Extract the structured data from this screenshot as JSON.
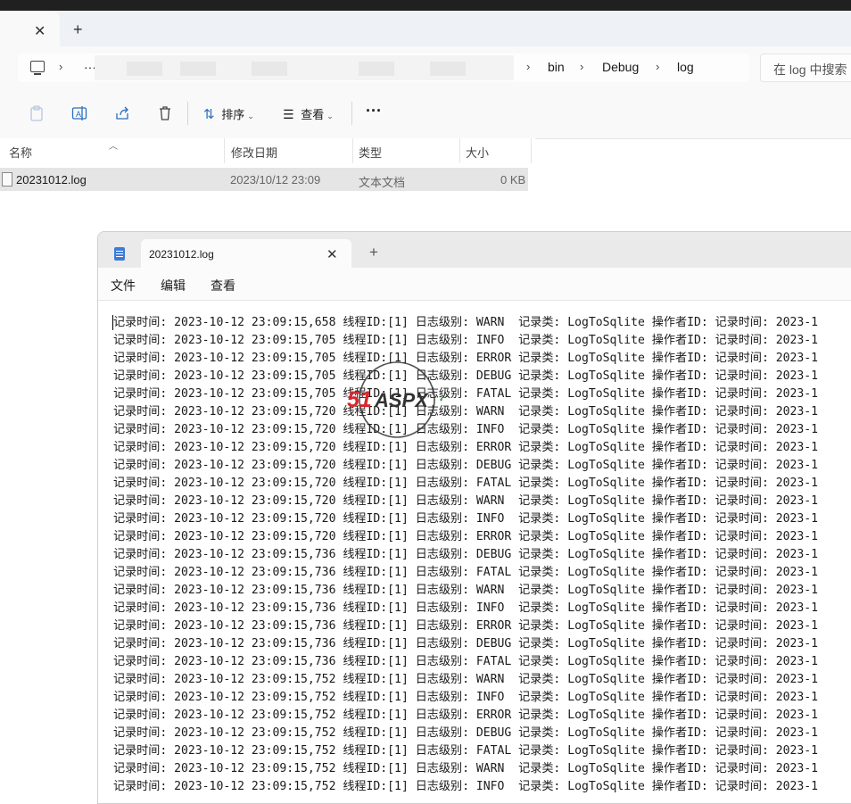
{
  "explorer": {
    "tab_close": "✕",
    "tab_new": "+",
    "breadcrumb": {
      "more": "···",
      "items": [
        "bin",
        "Debug",
        "log"
      ]
    },
    "search_placeholder": "在 log 中搜索",
    "toolbar": {
      "sort_label": "排序",
      "view_label": "查看",
      "more_label": "···"
    },
    "columns": [
      "名称",
      "修改日期",
      "类型",
      "大小"
    ],
    "files": [
      {
        "name": "20231012.log",
        "modified": "2023/10/12 23:09",
        "type": "文本文档",
        "size": "0 KB"
      }
    ]
  },
  "notepad": {
    "tab_title": "20231012.log",
    "tab_close": "✕",
    "tab_new": "+",
    "menu": [
      "文件",
      "编辑",
      "查看"
    ],
    "log_lines": [
      "记录时间: 2023-10-12 23:09:15,658 线程ID:[1] 日志级别: WARN  记录类: LogToSqlite 操作者ID: 记录时间: 2023-1",
      "记录时间: 2023-10-12 23:09:15,705 线程ID:[1] 日志级别: INFO  记录类: LogToSqlite 操作者ID: 记录时间: 2023-1",
      "记录时间: 2023-10-12 23:09:15,705 线程ID:[1] 日志级别: ERROR 记录类: LogToSqlite 操作者ID: 记录时间: 2023-1",
      "记录时间: 2023-10-12 23:09:15,705 线程ID:[1] 日志级别: DEBUG 记录类: LogToSqlite 操作者ID: 记录时间: 2023-1",
      "记录时间: 2023-10-12 23:09:15,705 线程ID:[1] 日志级别: FATAL 记录类: LogToSqlite 操作者ID: 记录时间: 2023-1",
      "记录时间: 2023-10-12 23:09:15,720 线程ID:[1] 日志级别: WARN  记录类: LogToSqlite 操作者ID: 记录时间: 2023-1",
      "记录时间: 2023-10-12 23:09:15,720 线程ID:[1] 日志级别: INFO  记录类: LogToSqlite 操作者ID: 记录时间: 2023-1",
      "记录时间: 2023-10-12 23:09:15,720 线程ID:[1] 日志级别: ERROR 记录类: LogToSqlite 操作者ID: 记录时间: 2023-1",
      "记录时间: 2023-10-12 23:09:15,720 线程ID:[1] 日志级别: DEBUG 记录类: LogToSqlite 操作者ID: 记录时间: 2023-1",
      "记录时间: 2023-10-12 23:09:15,720 线程ID:[1] 日志级别: FATAL 记录类: LogToSqlite 操作者ID: 记录时间: 2023-1",
      "记录时间: 2023-10-12 23:09:15,720 线程ID:[1] 日志级别: WARN  记录类: LogToSqlite 操作者ID: 记录时间: 2023-1",
      "记录时间: 2023-10-12 23:09:15,720 线程ID:[1] 日志级别: INFO  记录类: LogToSqlite 操作者ID: 记录时间: 2023-1",
      "记录时间: 2023-10-12 23:09:15,720 线程ID:[1] 日志级别: ERROR 记录类: LogToSqlite 操作者ID: 记录时间: 2023-1",
      "记录时间: 2023-10-12 23:09:15,736 线程ID:[1] 日志级别: DEBUG 记录类: LogToSqlite 操作者ID: 记录时间: 2023-1",
      "记录时间: 2023-10-12 23:09:15,736 线程ID:[1] 日志级别: FATAL 记录类: LogToSqlite 操作者ID: 记录时间: 2023-1",
      "记录时间: 2023-10-12 23:09:15,736 线程ID:[1] 日志级别: WARN  记录类: LogToSqlite 操作者ID: 记录时间: 2023-1",
      "记录时间: 2023-10-12 23:09:15,736 线程ID:[1] 日志级别: INFO  记录类: LogToSqlite 操作者ID: 记录时间: 2023-1",
      "记录时间: 2023-10-12 23:09:15,736 线程ID:[1] 日志级别: ERROR 记录类: LogToSqlite 操作者ID: 记录时间: 2023-1",
      "记录时间: 2023-10-12 23:09:15,736 线程ID:[1] 日志级别: DEBUG 记录类: LogToSqlite 操作者ID: 记录时间: 2023-1",
      "记录时间: 2023-10-12 23:09:15,736 线程ID:[1] 日志级别: FATAL 记录类: LogToSqlite 操作者ID: 记录时间: 2023-1",
      "记录时间: 2023-10-12 23:09:15,752 线程ID:[1] 日志级别: WARN  记录类: LogToSqlite 操作者ID: 记录时间: 2023-1",
      "记录时间: 2023-10-12 23:09:15,752 线程ID:[1] 日志级别: INFO  记录类: LogToSqlite 操作者ID: 记录时间: 2023-1",
      "记录时间: 2023-10-12 23:09:15,752 线程ID:[1] 日志级别: ERROR 记录类: LogToSqlite 操作者ID: 记录时间: 2023-1",
      "记录时间: 2023-10-12 23:09:15,752 线程ID:[1] 日志级别: DEBUG 记录类: LogToSqlite 操作者ID: 记录时间: 2023-1",
      "记录时间: 2023-10-12 23:09:15,752 线程ID:[1] 日志级别: FATAL 记录类: LogToSqlite 操作者ID: 记录时间: 2023-1",
      "记录时间: 2023-10-12 23:09:15,752 线程ID:[1] 日志级别: WARN  记录类: LogToSqlite 操作者ID: 记录时间: 2023-1",
      "记录时间: 2023-10-12 23:09:15,752 线程ID:[1] 日志级别: INFO  记录类: LogToSqlite 操作者ID: 记录时间: 2023-1"
    ]
  },
  "watermark": {
    "brand": "51ASPX"
  },
  "colors": {
    "accent": "#3d7bd8",
    "selection": "#e5e5e5",
    "titlebar": "#202020",
    "watermark_red": "#d9262c"
  }
}
